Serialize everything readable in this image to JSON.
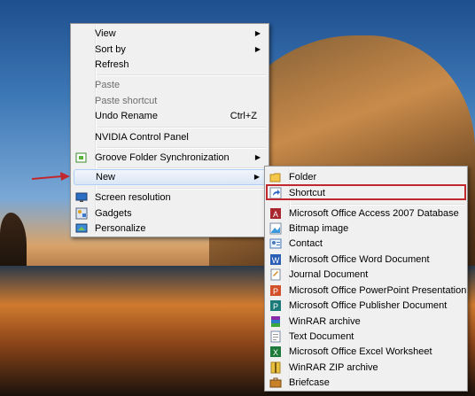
{
  "context_menu": {
    "items": [
      {
        "label": "View",
        "submenu": true
      },
      {
        "label": "Sort by",
        "submenu": true
      },
      {
        "label": "Refresh"
      },
      {
        "label": "Paste",
        "disabled": true
      },
      {
        "label": "Paste shortcut",
        "disabled": true
      },
      {
        "label": "Undo Rename",
        "shortcut": "Ctrl+Z"
      },
      {
        "label": "NVIDIA Control Panel"
      },
      {
        "label": "Groove Folder Synchronization",
        "submenu": true,
        "icon": "groove-sync-icon"
      },
      {
        "label": "New",
        "submenu": true,
        "highlighted": true
      },
      {
        "label": "Screen resolution",
        "icon": "screen-resolution-icon"
      },
      {
        "label": "Gadgets",
        "icon": "gadgets-icon"
      },
      {
        "label": "Personalize",
        "icon": "personalize-icon"
      }
    ]
  },
  "new_submenu": {
    "items": [
      {
        "label": "Folder",
        "icon": "folder-icon"
      },
      {
        "label": "Shortcut",
        "icon": "shortcut-icon",
        "highlighted": true
      },
      {
        "label": "Microsoft Office Access 2007 Database",
        "icon": "access-icon"
      },
      {
        "label": "Bitmap image",
        "icon": "bitmap-icon"
      },
      {
        "label": "Contact",
        "icon": "contact-icon"
      },
      {
        "label": "Microsoft Office Word Document",
        "icon": "word-icon"
      },
      {
        "label": "Journal Document",
        "icon": "journal-icon"
      },
      {
        "label": "Microsoft Office PowerPoint Presentation",
        "icon": "powerpoint-icon"
      },
      {
        "label": "Microsoft Office Publisher Document",
        "icon": "publisher-icon"
      },
      {
        "label": "WinRAR archive",
        "icon": "winrar-icon"
      },
      {
        "label": "Text Document",
        "icon": "text-document-icon"
      },
      {
        "label": "Microsoft Office Excel Worksheet",
        "icon": "excel-icon"
      },
      {
        "label": "WinRAR ZIP archive",
        "icon": "winrar-zip-icon"
      },
      {
        "label": "Briefcase",
        "icon": "briefcase-icon"
      }
    ]
  },
  "colors": {
    "annotation": "#c0282d",
    "menu_bg": "#f0f0f0",
    "hover_border": "#aecff7"
  }
}
